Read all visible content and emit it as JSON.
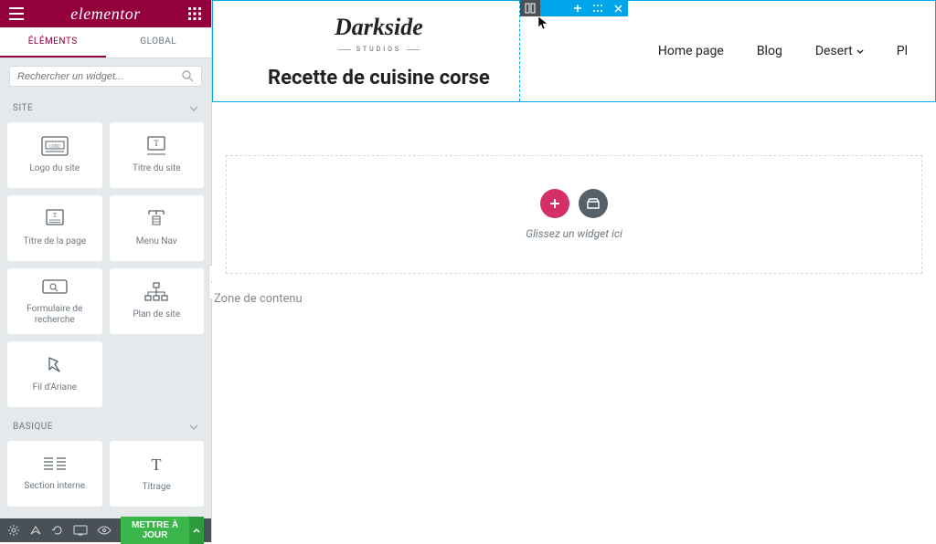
{
  "sidebar": {
    "brand": "elementor",
    "tabs": {
      "elements": "ÉLÉMENTS",
      "global": "GLOBAL"
    },
    "search_placeholder": "Rechercher un widget...",
    "categories": {
      "site": {
        "label": "SITE",
        "widgets": [
          {
            "label": "Logo du site",
            "icon": "logo"
          },
          {
            "label": "Titre du site",
            "icon": "site-title"
          },
          {
            "label": "Titre de la page",
            "icon": "page-title"
          },
          {
            "label": "Menu Nav",
            "icon": "nav-menu"
          },
          {
            "label": "Formulaire de recherche",
            "icon": "search-form"
          },
          {
            "label": "Plan de site",
            "icon": "sitemap"
          },
          {
            "label": "Fil d'Ariane",
            "icon": "breadcrumb"
          }
        ]
      },
      "basique": {
        "label": "BASIQUE",
        "widgets": [
          {
            "label": "Section interne",
            "icon": "columns"
          },
          {
            "label": "Titrage",
            "icon": "heading"
          }
        ]
      }
    },
    "footer": {
      "update_label": "METTRE À JOUR"
    }
  },
  "canvas": {
    "logo_title": "Darkside",
    "logo_sub": "STUDIOS",
    "page_title": "Recette de cuisine corse",
    "nav": [
      {
        "label": "Home page",
        "dropdown": false
      },
      {
        "label": "Blog",
        "dropdown": false
      },
      {
        "label": "Desert",
        "dropdown": true
      },
      {
        "label": "Pl",
        "dropdown": false
      }
    ],
    "drop_text": "Glissez un widget ici",
    "content_zone": "Zone de contenu"
  }
}
